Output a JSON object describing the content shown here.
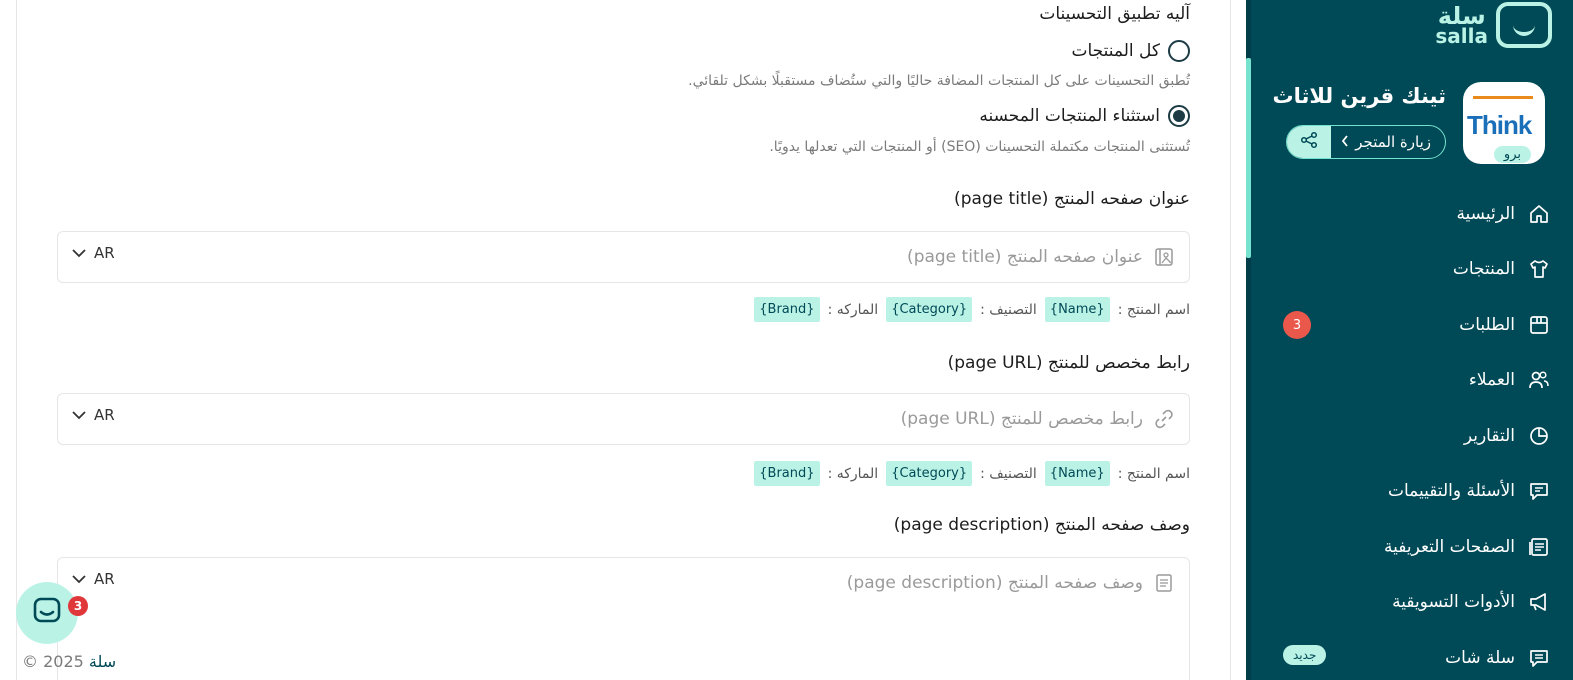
{
  "sidebar": {
    "logo": {
      "ar": "سلة",
      "en": "salla"
    },
    "store_name": "ثينك قرين للاثاث",
    "store_logo_text": "Think",
    "plan_badge": "برو",
    "visit_store": "زيارة المتجر",
    "items": [
      {
        "label": "الرئيسية",
        "icon": "home-icon"
      },
      {
        "label": "المنتجات",
        "icon": "tshirt-icon"
      },
      {
        "label": "الطلبات",
        "icon": "orders-box-icon",
        "badge": "3"
      },
      {
        "label": "العملاء",
        "icon": "users-icon"
      },
      {
        "label": "التقارير",
        "icon": "pie-chart-icon"
      },
      {
        "label": "الأسئلة والتقييمات",
        "icon": "reviews-icon"
      },
      {
        "label": "الصفحات التعريفية",
        "icon": "pages-icon"
      },
      {
        "label": "الأدوات التسويقية",
        "icon": "megaphone-icon"
      },
      {
        "label": "سلة شات",
        "icon": "chat-icon",
        "new_badge": "جديد"
      }
    ],
    "colors": {
      "background": "#004956",
      "accent": "#baf3e6",
      "badge": "#e9584b"
    }
  },
  "main": {
    "mechanism_title": "آليه تطبيق التحسينات",
    "options": [
      {
        "label": "كل المنتجات",
        "description": "تُطبق التحسينات على كل المنتجات المضافة حاليًا والتي ستُضاف مستقبلًا بشكل تلقائي.",
        "checked": false
      },
      {
        "label": "استثناء المنتجات المحسنه",
        "description": "تُستثنى المنتجات مكتملة التحسينات (SEO) أو المنتجات التي تعدلها يدويًا.",
        "checked": true
      }
    ],
    "fields": [
      {
        "label": "عنوان صفحه المنتج (page title)",
        "placeholder": "عنوان صفحه المنتج (page title)",
        "icon": "image-field-icon",
        "lang": "AR",
        "tags": {
          "name_label": "اسم المنتج :",
          "name_tag": "{Name}",
          "category_label": "التصنيف :",
          "category_tag": "{Category}",
          "brand_label": "الماركه :",
          "brand_tag": "{Brand}"
        }
      },
      {
        "label": "رابط مخصص للمنتج (page URL)",
        "placeholder": "رابط مخصص للمنتج (page URL)",
        "icon": "link-icon",
        "lang": "AR",
        "tags": {
          "name_label": "اسم المنتج :",
          "name_tag": "{Name}",
          "category_label": "التصنيف :",
          "category_tag": "{Category}",
          "brand_label": "الماركه :",
          "brand_tag": "{Brand}"
        }
      },
      {
        "label": "وصف صفحه المنتج (page description)",
        "placeholder": "وصف صفحه المنتج (page description)",
        "icon": "document-icon",
        "lang": "AR"
      }
    ]
  },
  "footer": {
    "brand": "سلة",
    "copyright": "© 2025"
  },
  "chat_widget": {
    "badge": "3"
  }
}
